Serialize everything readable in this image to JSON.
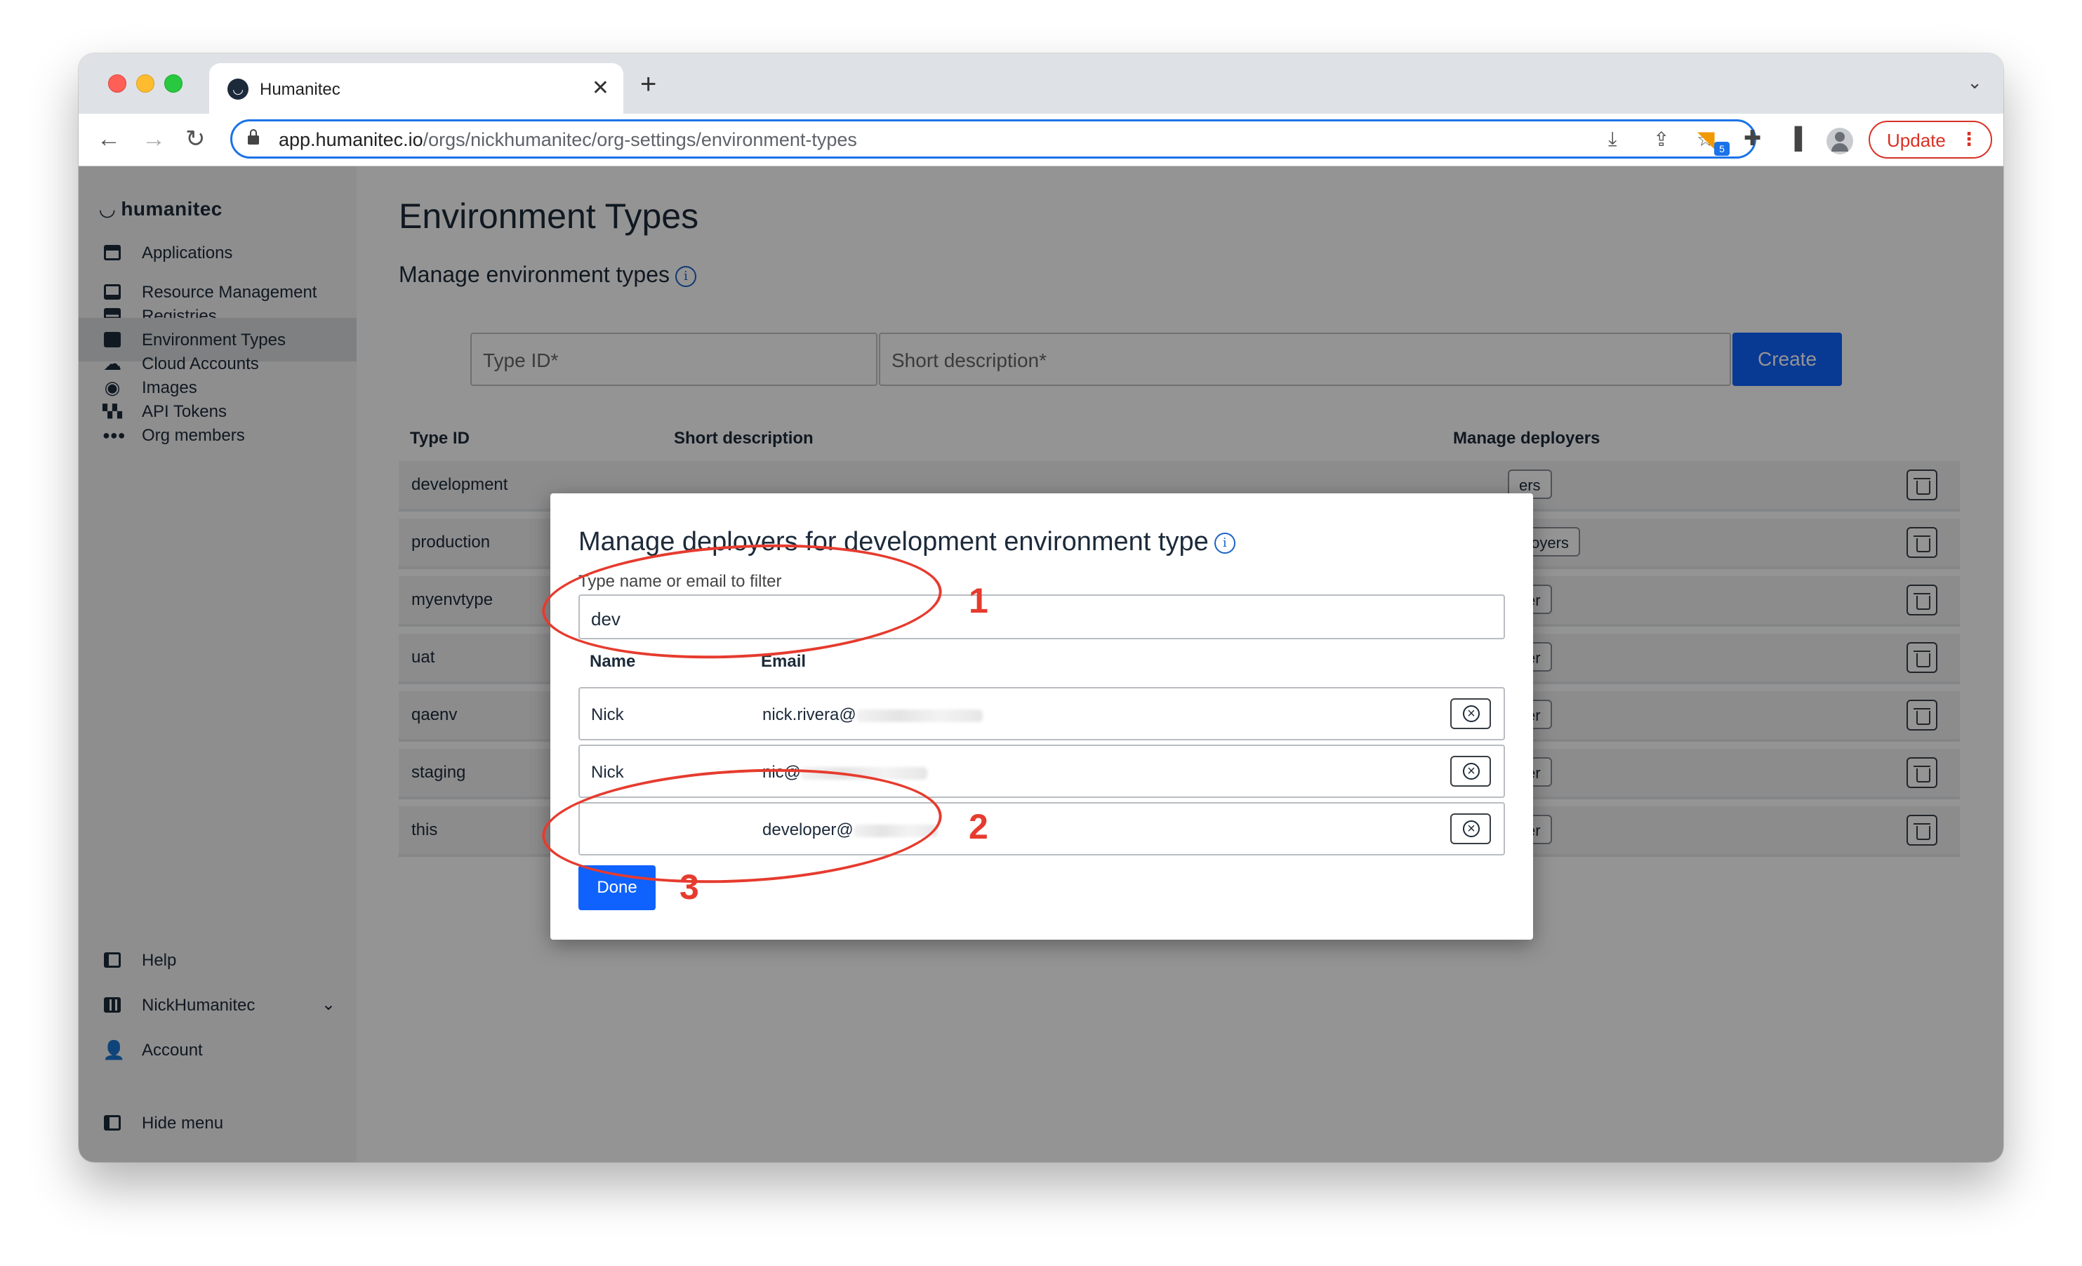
{
  "browser": {
    "tab_title": "Humanitec",
    "tab_close": "✕",
    "new_tab": "+",
    "url_host": "app.humanitec.io",
    "url_path": "/orgs/nickhumanitec/org-settings/environment-types",
    "extension_badge": "5",
    "update_label": "Update",
    "update_menu": "⋮"
  },
  "sidebar": {
    "logo": "humanitec",
    "items": [
      {
        "label": "Applications"
      },
      {
        "label": "Resource Management"
      },
      {
        "label": "Registries"
      },
      {
        "label": "Environment Types"
      },
      {
        "label": "Cloud Accounts"
      },
      {
        "label": "Images"
      },
      {
        "label": "API Tokens"
      },
      {
        "label": "Org members"
      }
    ],
    "bottom": [
      {
        "label": "Help"
      },
      {
        "label": "NickHumanitec"
      },
      {
        "label": "Account"
      },
      {
        "label": "Hide menu"
      }
    ]
  },
  "main": {
    "title": "Environment Types",
    "subtitle": "Manage environment types",
    "type_id_placeholder": "Type ID*",
    "description_placeholder": "Short description*",
    "create_label": "Create",
    "columns": {
      "type_id": "Type ID",
      "description": "Short description",
      "deployers": "Manage deployers"
    },
    "rows": [
      {
        "type_id": "development",
        "deployers": "ers"
      },
      {
        "type_id": "production",
        "deployers": "ployers"
      },
      {
        "type_id": "myenvtype",
        "deployers": "yer"
      },
      {
        "type_id": "uat",
        "deployers": "yer"
      },
      {
        "type_id": "qaenv",
        "deployers": "yer"
      },
      {
        "type_id": "staging",
        "deployers": "yer"
      },
      {
        "type_id": "this",
        "deployers": "yer"
      }
    ]
  },
  "modal": {
    "title": "Manage deployers for development environment type",
    "filter_label": "Type name or email to filter",
    "filter_value": "dev",
    "col_name": "Name",
    "col_email": "Email",
    "users": [
      {
        "name": "Nick",
        "email": "nick.rivera@"
      },
      {
        "name": "Nick",
        "email": "nic@"
      },
      {
        "name": "",
        "email": "developer@"
      }
    ],
    "done_label": "Done"
  },
  "annotations": {
    "n1": "1",
    "n2": "2",
    "n3": "3",
    "color": "#e63b2e"
  },
  "colors": {
    "primary": "#0f62fe",
    "sidebar_bg": "#f4f5f6",
    "update": "#d93025"
  }
}
